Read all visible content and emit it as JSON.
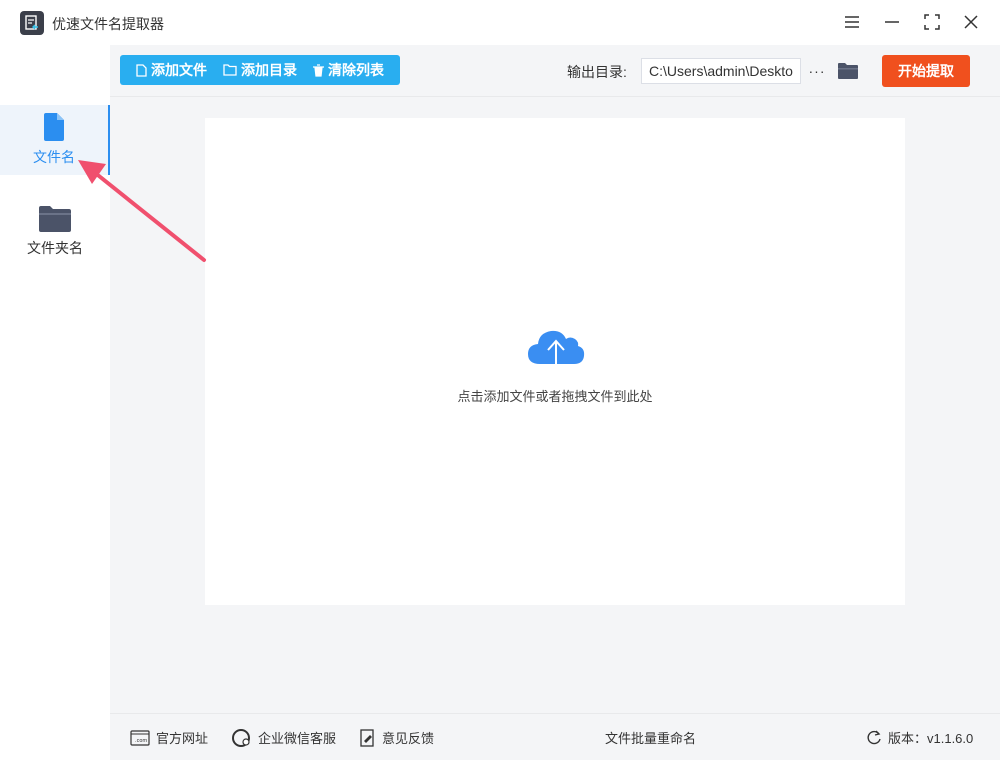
{
  "window": {
    "title": "优速文件名提取器",
    "controls": [
      "menu-icon",
      "minimize-icon",
      "maximize-icon",
      "close-icon"
    ]
  },
  "sidebar": {
    "items": [
      {
        "label": "文件名",
        "icon": "file-icon",
        "active": true
      },
      {
        "label": "文件夹名",
        "icon": "folder-icon",
        "active": false
      }
    ]
  },
  "toolbar": {
    "add_file": "添加文件",
    "add_dir": "添加目录",
    "clear_list": "清除列表",
    "output_label": "输出目录:",
    "output_value": "C:\\Users\\admin\\Deskto",
    "more": "···",
    "start": "开始提取"
  },
  "drop_area": {
    "hint": "点击添加文件或者拖拽文件到此处",
    "icon": "cloud-upload-icon"
  },
  "footer": {
    "site": "官方网址",
    "wechat": "企业微信客服",
    "feedback": "意见反馈",
    "rename": "文件批量重命名",
    "version": "版本：v1.1.6.0"
  },
  "colors": {
    "accent_blue": "#29aef0",
    "active_blue": "#2b8ef0",
    "start_orange": "#f0501e",
    "arrow_pink": "#f0506e"
  }
}
